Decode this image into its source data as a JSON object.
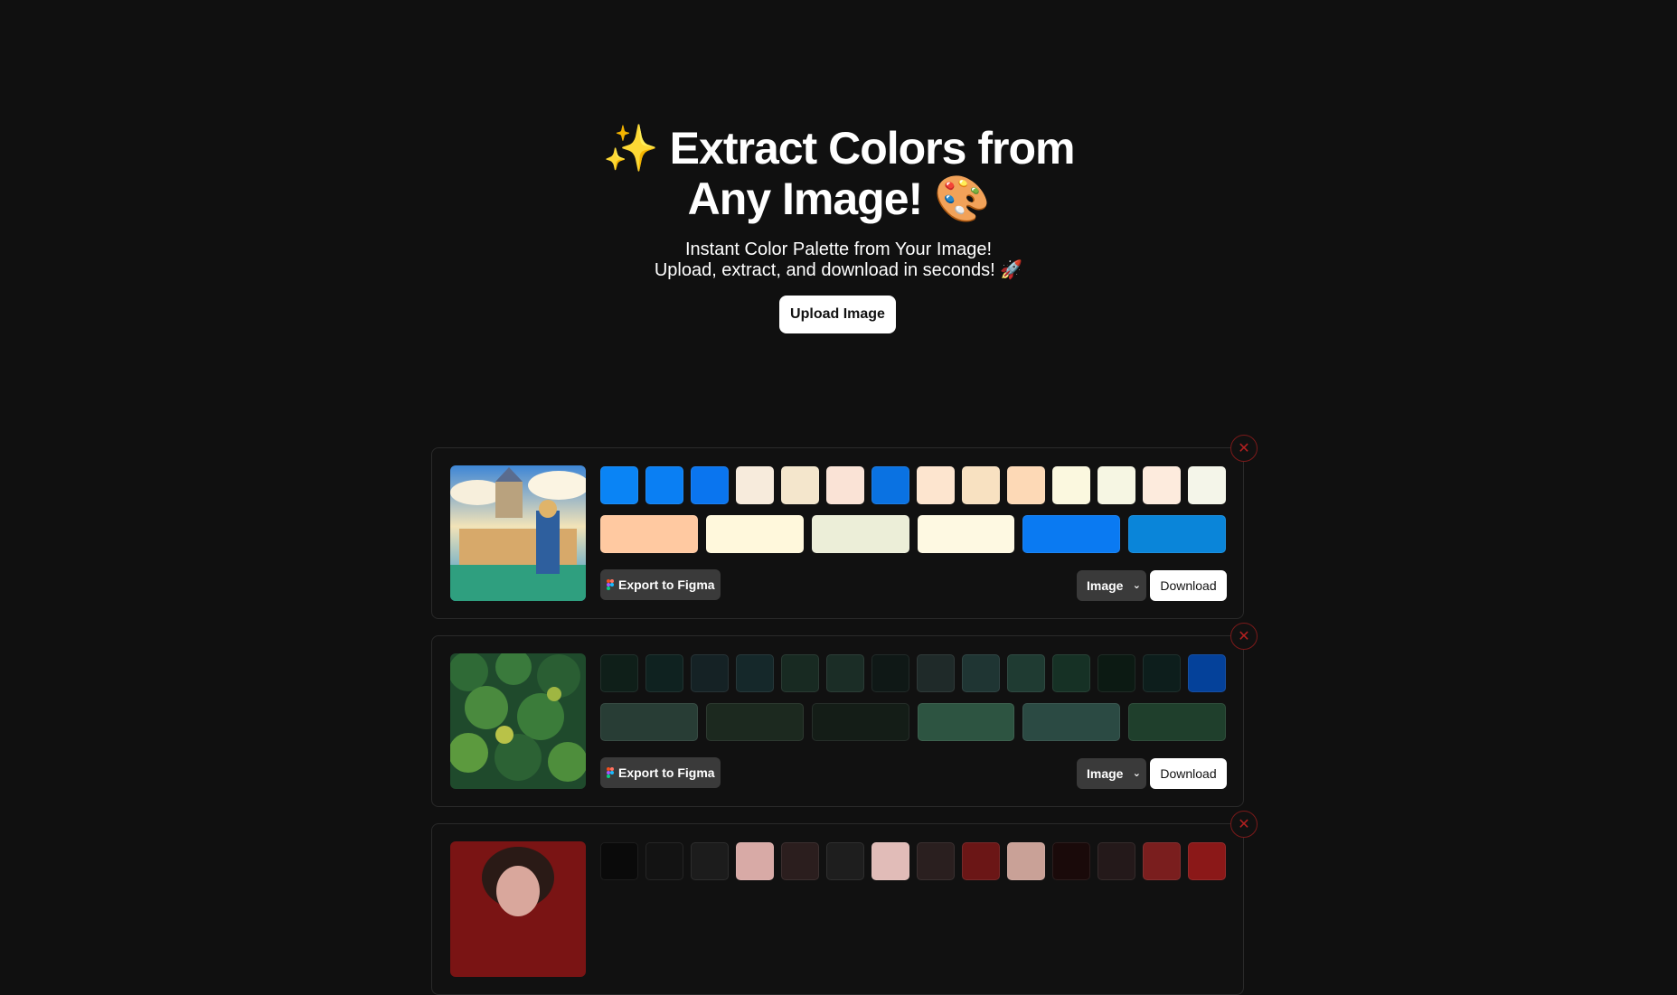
{
  "hero": {
    "title_line1": "✨ Extract Colors from",
    "title_line2": "Any Image! 🎨",
    "subtitle_line1": "Instant Color Palette from Your Image!",
    "subtitle_line2": "Upload, extract, and download in seconds! 🚀",
    "upload_label": "Upload Image"
  },
  "cards": [
    {
      "thumb_icon": "castle-landscape-image",
      "top_swatches": [
        "#0a84f5",
        "#0a7ff3",
        "#0a75ef",
        "#f7ebdc",
        "#f4e6cc",
        "#fae3d6",
        "#0a72e2",
        "#fde5cf",
        "#f8e1c1",
        "#fdd9b6",
        "#fbf8df",
        "#f6f6e3",
        "#fdebdd",
        "#f4f5e9"
      ],
      "bottom_swatches": [
        "#ffc9a1",
        "#fff8dc",
        "#eceed8",
        "#fef9e2",
        "#0a7af2",
        "#0a85d9"
      ],
      "figma_label": "Export to Figma",
      "format_value": "Image",
      "download_label": "Download"
    },
    {
      "thumb_icon": "forest-image",
      "top_swatches": [
        "#0f1f19",
        "#0f2220",
        "#152225",
        "#15282a",
        "#182a22",
        "#1b2d26",
        "#0f1816",
        "#1f2a29",
        "#1f3533",
        "#1f3b32",
        "#163125",
        "#0c1a13",
        "#0d1e1c",
        "#04419a"
      ],
      "bottom_swatches": [
        "#283d35",
        "#1c291f",
        "#141d17",
        "#2d5441",
        "#2b4a43",
        "#1f3f2c"
      ],
      "figma_label": "Export to Figma",
      "format_value": "Image",
      "download_label": "Download"
    },
    {
      "thumb_icon": "portrait-image",
      "top_swatches": [
        "#0a0a0a",
        "#131313",
        "#1c1c1c",
        "#d8aaa6",
        "#2b1e1e",
        "#1e1e1e",
        "#e1bcb8",
        "#2a1f1f",
        "#6b1616",
        "#c9a197",
        "#1a0a0a",
        "#24191a",
        "#7a1e1e",
        "#8b1818"
      ]
    }
  ]
}
